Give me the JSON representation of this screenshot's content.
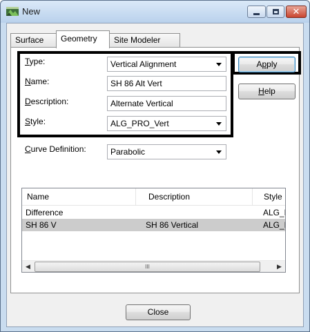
{
  "window": {
    "title": "New"
  },
  "tabs": [
    {
      "label": "Surface"
    },
    {
      "label": "Geometry"
    },
    {
      "label": "Site Modeler"
    }
  ],
  "form": {
    "type": {
      "label_mn": "T",
      "label_rest": "ype:",
      "value": "Vertical Alignment"
    },
    "name": {
      "label_mn": "N",
      "label_rest": "ame:",
      "value": "SH 86 Alt Vert"
    },
    "description": {
      "label_mn": "D",
      "label_rest": "escription:",
      "value": "Alternate Vertical"
    },
    "style": {
      "label_mn": "S",
      "label_rest": "tyle:",
      "value": "ALG_PRO_Vert"
    },
    "curve_definition": {
      "label_mn": "C",
      "label_rest": "urve Definition:",
      "value": "Parabolic"
    }
  },
  "buttons": {
    "apply": {
      "label_pre": "A",
      "label_mn": "p",
      "label_post": "ply"
    },
    "help": {
      "label_mn": "H",
      "label_rest": "elp"
    },
    "close": "Close"
  },
  "list": {
    "columns": [
      "Name",
      "Description",
      "Style"
    ],
    "rows": [
      {
        "name": "Difference",
        "description": "",
        "style": "ALG_E",
        "selected": false
      },
      {
        "name": "SH 86 V",
        "description": "SH 86 Vertical",
        "style": "ALG_F",
        "selected": true
      }
    ],
    "scroll_left": "◀",
    "scroll_right": "▶",
    "scroll_grip": "III"
  },
  "icons": {
    "app": "window-app-icon",
    "minimize": "minimize-icon",
    "maximize": "maximize-icon",
    "close": "close-icon",
    "close_glyph": "✕"
  }
}
